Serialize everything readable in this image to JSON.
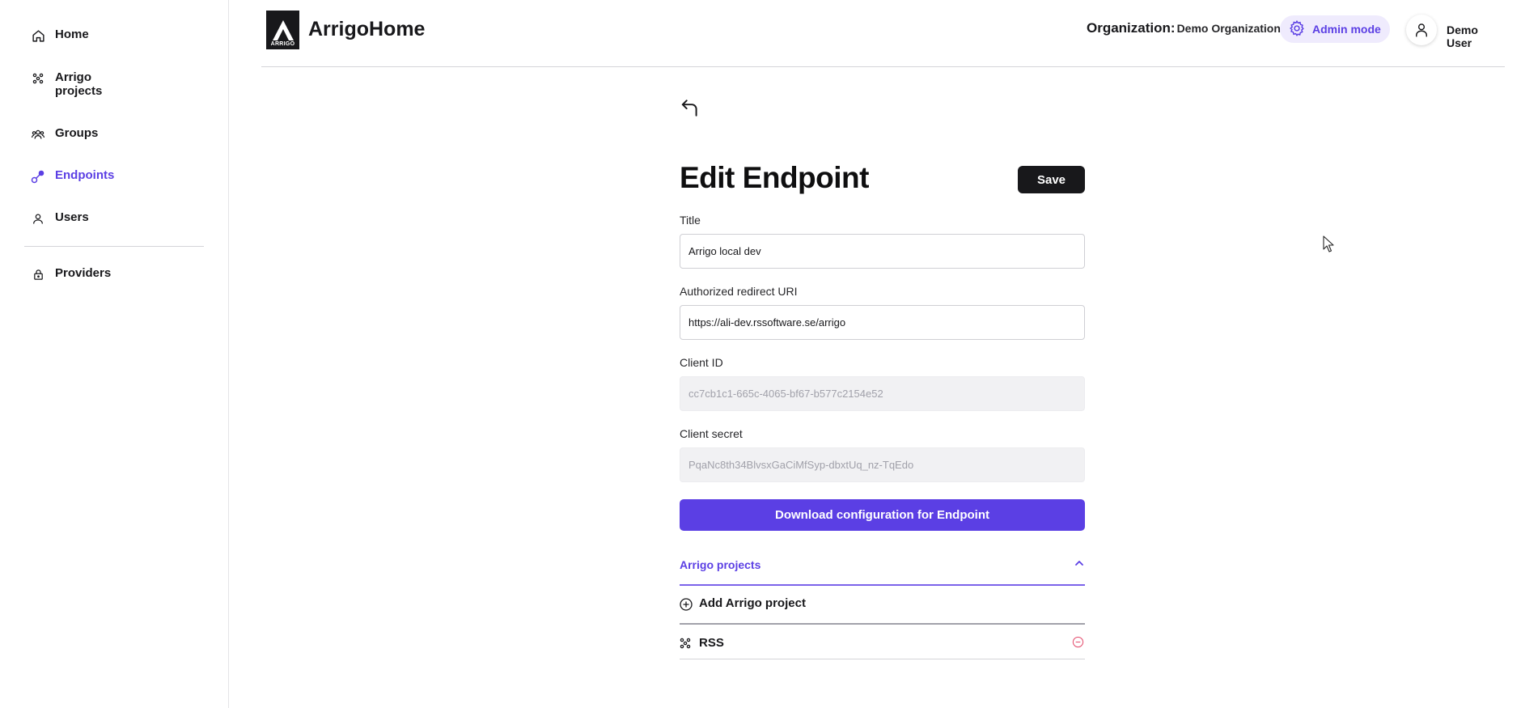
{
  "app": {
    "name": "ArrigoHome",
    "logo_text": "ARRIGO"
  },
  "sidebar": {
    "items": [
      {
        "label": "Home",
        "icon": "home-icon"
      },
      {
        "label": "Arrigo projects",
        "icon": "dots-cluster-icon"
      },
      {
        "label": "Groups",
        "icon": "group-icon"
      },
      {
        "label": "Endpoints",
        "icon": "endpoint-icon",
        "active": true
      },
      {
        "label": "Users",
        "icon": "user-icon"
      },
      {
        "label": "Providers",
        "icon": "lock-icon"
      }
    ]
  },
  "header": {
    "org_label": "Organization:",
    "org_name": "Demo Organization",
    "admin_label": "Admin mode",
    "user_name": "Demo User"
  },
  "form": {
    "title": "Edit Endpoint",
    "save_label": "Save",
    "fields": {
      "title": {
        "label": "Title",
        "value": "Arrigo local dev"
      },
      "redirect": {
        "label": "Authorized redirect URI",
        "value": "https://ali-dev.rssoftware.se/arrigo"
      },
      "client_id": {
        "label": "Client ID",
        "value": "cc7cb1c1-665c-4065-bf67-b577c2154e52"
      },
      "client_secret": {
        "label": "Client secret",
        "value": "PqaNc8th34BlvsxGaCiMfSyp-dbxtUq_nz-TqEdo"
      }
    },
    "download_label": "Download configuration for Endpoint"
  },
  "projects": {
    "title": "Arrigo projects",
    "add_label": "Add Arrigo project",
    "items": [
      {
        "label": "RSS"
      }
    ]
  },
  "colors": {
    "accent": "#5b3fe4",
    "dark": "#18181b",
    "danger": "#e65a78"
  }
}
